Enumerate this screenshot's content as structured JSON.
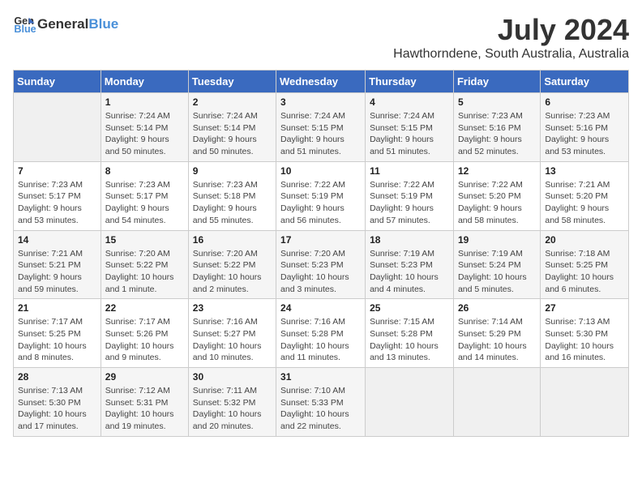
{
  "header": {
    "logo_general": "General",
    "logo_blue": "Blue",
    "title": "July 2024",
    "subtitle": "Hawthorndene, South Australia, Australia"
  },
  "calendar": {
    "columns": [
      "Sunday",
      "Monday",
      "Tuesday",
      "Wednesday",
      "Thursday",
      "Friday",
      "Saturday"
    ],
    "rows": [
      [
        {
          "day": "",
          "info": ""
        },
        {
          "day": "1",
          "info": "Sunrise: 7:24 AM\nSunset: 5:14 PM\nDaylight: 9 hours\nand 50 minutes."
        },
        {
          "day": "2",
          "info": "Sunrise: 7:24 AM\nSunset: 5:14 PM\nDaylight: 9 hours\nand 50 minutes."
        },
        {
          "day": "3",
          "info": "Sunrise: 7:24 AM\nSunset: 5:15 PM\nDaylight: 9 hours\nand 51 minutes."
        },
        {
          "day": "4",
          "info": "Sunrise: 7:24 AM\nSunset: 5:15 PM\nDaylight: 9 hours\nand 51 minutes."
        },
        {
          "day": "5",
          "info": "Sunrise: 7:23 AM\nSunset: 5:16 PM\nDaylight: 9 hours\nand 52 minutes."
        },
        {
          "day": "6",
          "info": "Sunrise: 7:23 AM\nSunset: 5:16 PM\nDaylight: 9 hours\nand 53 minutes."
        }
      ],
      [
        {
          "day": "7",
          "info": "Sunrise: 7:23 AM\nSunset: 5:17 PM\nDaylight: 9 hours\nand 53 minutes."
        },
        {
          "day": "8",
          "info": "Sunrise: 7:23 AM\nSunset: 5:17 PM\nDaylight: 9 hours\nand 54 minutes."
        },
        {
          "day": "9",
          "info": "Sunrise: 7:23 AM\nSunset: 5:18 PM\nDaylight: 9 hours\nand 55 minutes."
        },
        {
          "day": "10",
          "info": "Sunrise: 7:22 AM\nSunset: 5:19 PM\nDaylight: 9 hours\nand 56 minutes."
        },
        {
          "day": "11",
          "info": "Sunrise: 7:22 AM\nSunset: 5:19 PM\nDaylight: 9 hours\nand 57 minutes."
        },
        {
          "day": "12",
          "info": "Sunrise: 7:22 AM\nSunset: 5:20 PM\nDaylight: 9 hours\nand 58 minutes."
        },
        {
          "day": "13",
          "info": "Sunrise: 7:21 AM\nSunset: 5:20 PM\nDaylight: 9 hours\nand 58 minutes."
        }
      ],
      [
        {
          "day": "14",
          "info": "Sunrise: 7:21 AM\nSunset: 5:21 PM\nDaylight: 9 hours\nand 59 minutes."
        },
        {
          "day": "15",
          "info": "Sunrise: 7:20 AM\nSunset: 5:22 PM\nDaylight: 10 hours\nand 1 minute."
        },
        {
          "day": "16",
          "info": "Sunrise: 7:20 AM\nSunset: 5:22 PM\nDaylight: 10 hours\nand 2 minutes."
        },
        {
          "day": "17",
          "info": "Sunrise: 7:20 AM\nSunset: 5:23 PM\nDaylight: 10 hours\nand 3 minutes."
        },
        {
          "day": "18",
          "info": "Sunrise: 7:19 AM\nSunset: 5:23 PM\nDaylight: 10 hours\nand 4 minutes."
        },
        {
          "day": "19",
          "info": "Sunrise: 7:19 AM\nSunset: 5:24 PM\nDaylight: 10 hours\nand 5 minutes."
        },
        {
          "day": "20",
          "info": "Sunrise: 7:18 AM\nSunset: 5:25 PM\nDaylight: 10 hours\nand 6 minutes."
        }
      ],
      [
        {
          "day": "21",
          "info": "Sunrise: 7:17 AM\nSunset: 5:25 PM\nDaylight: 10 hours\nand 8 minutes."
        },
        {
          "day": "22",
          "info": "Sunrise: 7:17 AM\nSunset: 5:26 PM\nDaylight: 10 hours\nand 9 minutes."
        },
        {
          "day": "23",
          "info": "Sunrise: 7:16 AM\nSunset: 5:27 PM\nDaylight: 10 hours\nand 10 minutes."
        },
        {
          "day": "24",
          "info": "Sunrise: 7:16 AM\nSunset: 5:28 PM\nDaylight: 10 hours\nand 11 minutes."
        },
        {
          "day": "25",
          "info": "Sunrise: 7:15 AM\nSunset: 5:28 PM\nDaylight: 10 hours\nand 13 minutes."
        },
        {
          "day": "26",
          "info": "Sunrise: 7:14 AM\nSunset: 5:29 PM\nDaylight: 10 hours\nand 14 minutes."
        },
        {
          "day": "27",
          "info": "Sunrise: 7:13 AM\nSunset: 5:30 PM\nDaylight: 10 hours\nand 16 minutes."
        }
      ],
      [
        {
          "day": "28",
          "info": "Sunrise: 7:13 AM\nSunset: 5:30 PM\nDaylight: 10 hours\nand 17 minutes."
        },
        {
          "day": "29",
          "info": "Sunrise: 7:12 AM\nSunset: 5:31 PM\nDaylight: 10 hours\nand 19 minutes."
        },
        {
          "day": "30",
          "info": "Sunrise: 7:11 AM\nSunset: 5:32 PM\nDaylight: 10 hours\nand 20 minutes."
        },
        {
          "day": "31",
          "info": "Sunrise: 7:10 AM\nSunset: 5:33 PM\nDaylight: 10 hours\nand 22 minutes."
        },
        {
          "day": "",
          "info": ""
        },
        {
          "day": "",
          "info": ""
        },
        {
          "day": "",
          "info": ""
        }
      ]
    ]
  }
}
